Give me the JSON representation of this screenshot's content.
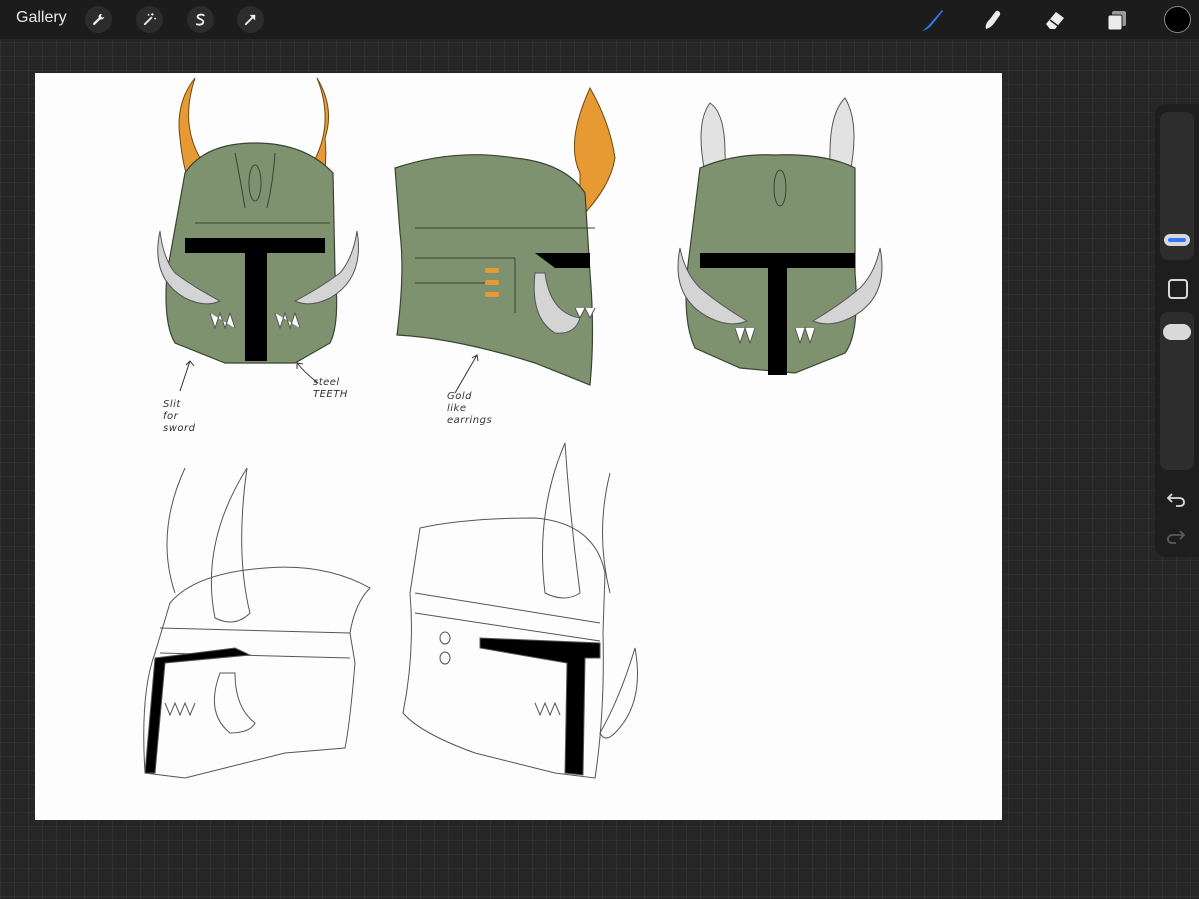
{
  "topbar": {
    "gallery_label": "Gallery",
    "left_tools": [
      {
        "name": "wrench-icon"
      },
      {
        "name": "magic-wand-icon"
      },
      {
        "name": "selection-icon"
      },
      {
        "name": "transform-arrow-icon"
      }
    ],
    "right_tools": [
      {
        "name": "brush-icon",
        "active_color": "#2f7bf5"
      },
      {
        "name": "smudge-icon"
      },
      {
        "name": "eraser-icon"
      },
      {
        "name": "layers-icon"
      }
    ],
    "current_color": "#000000"
  },
  "canvas": {
    "annotations": {
      "slit": "Slit\nfor\nsword",
      "teeth": "steel\nTEETH",
      "gold": "Gold\nlike\nearrings"
    },
    "colors": {
      "helmet_green": "#7f9270",
      "horn_orange": "#e79a33",
      "horn_gray": "#d4d4d4",
      "visor_black": "#000000"
    }
  },
  "sidebar": {
    "undo_icon": "undo-icon",
    "redo_icon": "redo-icon",
    "modify_icon": "modify-square-icon"
  }
}
